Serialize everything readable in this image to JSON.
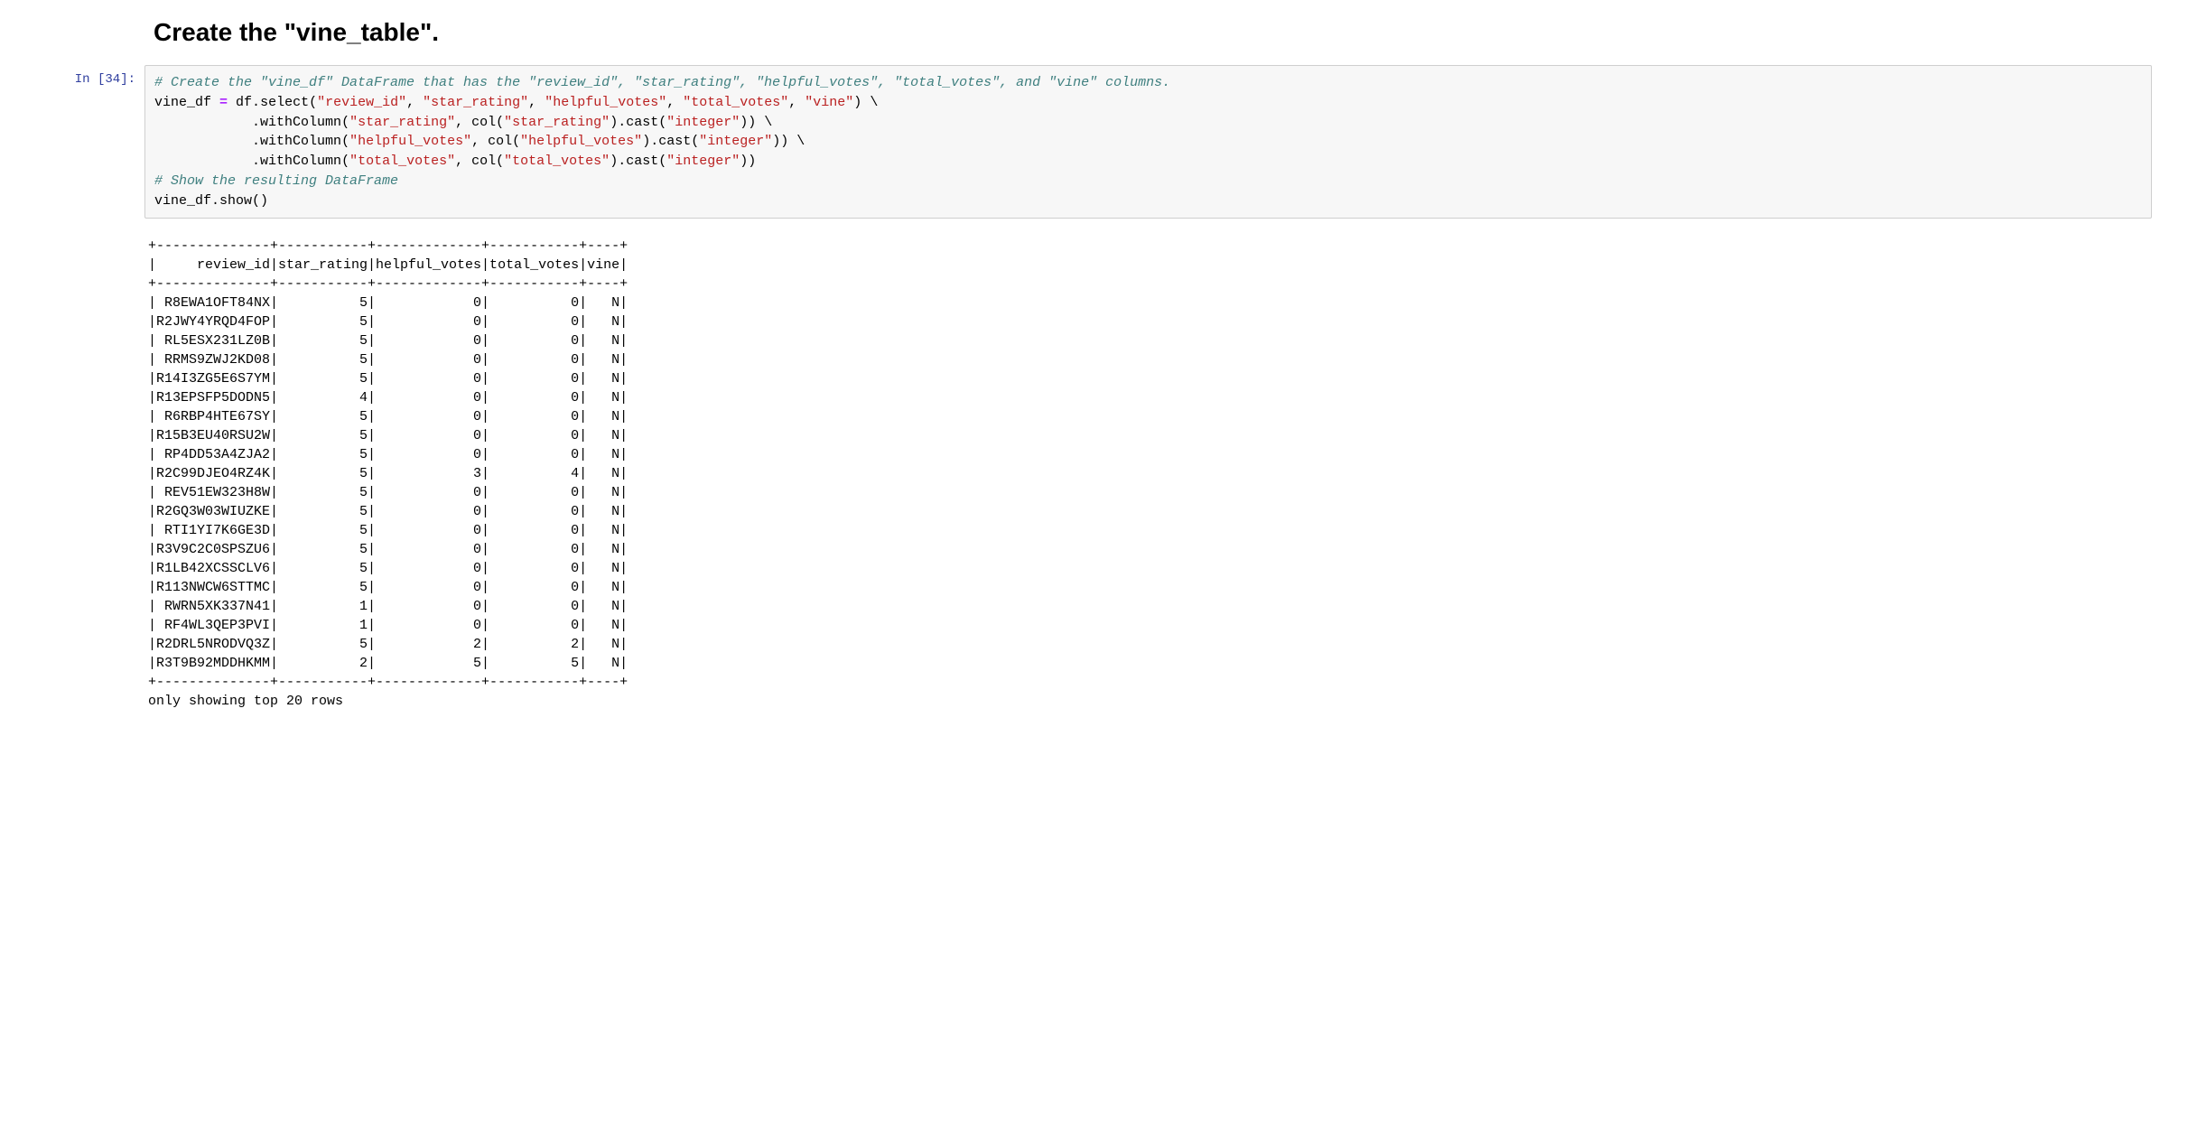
{
  "markdown": {
    "heading": "Create the \"vine_table\"."
  },
  "prompt": {
    "label": "In [34]:"
  },
  "code": {
    "comment1": "# Create the \"vine_df\" DataFrame that has the \"review_id\", \"star_rating\", \"helpful_votes\", \"total_votes\", and \"vine\" columns.",
    "lhs": "vine_df",
    "eq": " = ",
    "df": "df",
    "dot": ".",
    "select": "select",
    "lp": "(",
    "rp": ")",
    "comma": ", ",
    "s_review_id": "\"review_id\"",
    "s_star_rating": "\"star_rating\"",
    "s_helpful_votes": "\"helpful_votes\"",
    "s_total_votes": "\"total_votes\"",
    "s_vine": "\"vine\"",
    "s_integer": "\"integer\"",
    "bscont": " \\",
    "indent": "            ",
    "withColumn": "withColumn",
    "col": "col",
    "cast": "cast",
    "comment2": "# Show the resulting DataFrame",
    "show_lhs": "vine_df",
    "show": "show",
    "emptyparens": "()"
  },
  "output": {
    "sep": "+--------------+-----------+-------------+-----------+----+",
    "header": "|     review_id|star_rating|helpful_votes|total_votes|vine|",
    "footer": "only showing top 20 rows",
    "columns": [
      "review_id",
      "star_rating",
      "helpful_votes",
      "total_votes",
      "vine"
    ],
    "rows": [
      {
        "review_id": "R8EWA1OFT84NX",
        "star_rating": 5,
        "helpful_votes": 0,
        "total_votes": 0,
        "vine": "N"
      },
      {
        "review_id": "R2JWY4YRQD4FOP",
        "star_rating": 5,
        "helpful_votes": 0,
        "total_votes": 0,
        "vine": "N"
      },
      {
        "review_id": "RL5ESX231LZ0B",
        "star_rating": 5,
        "helpful_votes": 0,
        "total_votes": 0,
        "vine": "N"
      },
      {
        "review_id": "RRMS9ZWJ2KD08",
        "star_rating": 5,
        "helpful_votes": 0,
        "total_votes": 0,
        "vine": "N"
      },
      {
        "review_id": "R14I3ZG5E6S7YM",
        "star_rating": 5,
        "helpful_votes": 0,
        "total_votes": 0,
        "vine": "N"
      },
      {
        "review_id": "R13EPSFP5DODN5",
        "star_rating": 4,
        "helpful_votes": 0,
        "total_votes": 0,
        "vine": "N"
      },
      {
        "review_id": "R6RBP4HTE67SY",
        "star_rating": 5,
        "helpful_votes": 0,
        "total_votes": 0,
        "vine": "N"
      },
      {
        "review_id": "R15B3EU40RSU2W",
        "star_rating": 5,
        "helpful_votes": 0,
        "total_votes": 0,
        "vine": "N"
      },
      {
        "review_id": "RP4DD53A4ZJA2",
        "star_rating": 5,
        "helpful_votes": 0,
        "total_votes": 0,
        "vine": "N"
      },
      {
        "review_id": "R2C99DJEO4RZ4K",
        "star_rating": 5,
        "helpful_votes": 3,
        "total_votes": 4,
        "vine": "N"
      },
      {
        "review_id": "REV51EW323H8W",
        "star_rating": 5,
        "helpful_votes": 0,
        "total_votes": 0,
        "vine": "N"
      },
      {
        "review_id": "R2GQ3W03WIUZKE",
        "star_rating": 5,
        "helpful_votes": 0,
        "total_votes": 0,
        "vine": "N"
      },
      {
        "review_id": "RTI1YI7K6GE3D",
        "star_rating": 5,
        "helpful_votes": 0,
        "total_votes": 0,
        "vine": "N"
      },
      {
        "review_id": "R3V9C2C0SPSZU6",
        "star_rating": 5,
        "helpful_votes": 0,
        "total_votes": 0,
        "vine": "N"
      },
      {
        "review_id": "R1LB42XCSSCLV6",
        "star_rating": 5,
        "helpful_votes": 0,
        "total_votes": 0,
        "vine": "N"
      },
      {
        "review_id": "R113NWCW6STTMC",
        "star_rating": 5,
        "helpful_votes": 0,
        "total_votes": 0,
        "vine": "N"
      },
      {
        "review_id": "RWRN5XK337N41",
        "star_rating": 1,
        "helpful_votes": 0,
        "total_votes": 0,
        "vine": "N"
      },
      {
        "review_id": "RF4WL3QEP3PVI",
        "star_rating": 1,
        "helpful_votes": 0,
        "total_votes": 0,
        "vine": "N"
      },
      {
        "review_id": "R2DRL5NRODVQ3Z",
        "star_rating": 5,
        "helpful_votes": 2,
        "total_votes": 2,
        "vine": "N"
      },
      {
        "review_id": "R3T9B92MDDHKMM",
        "star_rating": 2,
        "helpful_votes": 5,
        "total_votes": 5,
        "vine": "N"
      }
    ],
    "widths": {
      "review_id": 14,
      "star_rating": 11,
      "helpful_votes": 13,
      "total_votes": 11,
      "vine": 4
    }
  },
  "chart_data": {
    "type": "table",
    "title": "vine_df top 20 rows",
    "columns": [
      "review_id",
      "star_rating",
      "helpful_votes",
      "total_votes",
      "vine"
    ],
    "rows": [
      [
        "R8EWA1OFT84NX",
        5,
        0,
        0,
        "N"
      ],
      [
        "R2JWY4YRQD4FOP",
        5,
        0,
        0,
        "N"
      ],
      [
        "RL5ESX231LZ0B",
        5,
        0,
        0,
        "N"
      ],
      [
        "RRMS9ZWJ2KD08",
        5,
        0,
        0,
        "N"
      ],
      [
        "R14I3ZG5E6S7YM",
        5,
        0,
        0,
        "N"
      ],
      [
        "R13EPSFP5DODN5",
        4,
        0,
        0,
        "N"
      ],
      [
        "R6RBP4HTE67SY",
        5,
        0,
        0,
        "N"
      ],
      [
        "R15B3EU40RSU2W",
        5,
        0,
        0,
        "N"
      ],
      [
        "RP4DD53A4ZJA2",
        5,
        0,
        0,
        "N"
      ],
      [
        "R2C99DJEO4RZ4K",
        5,
        3,
        4,
        "N"
      ],
      [
        "REV51EW323H8W",
        5,
        0,
        0,
        "N"
      ],
      [
        "R2GQ3W03WIUZKE",
        5,
        0,
        0,
        "N"
      ],
      [
        "RTI1YI7K6GE3D",
        5,
        0,
        0,
        "N"
      ],
      [
        "R3V9C2C0SPSZU6",
        5,
        0,
        0,
        "N"
      ],
      [
        "R1LB42XCSSCLV6",
        5,
        0,
        0,
        "N"
      ],
      [
        "R113NWCW6STTMC",
        5,
        0,
        0,
        "N"
      ],
      [
        "RWRN5XK337N41",
        1,
        0,
        0,
        "N"
      ],
      [
        "RF4WL3QEP3PVI",
        1,
        0,
        0,
        "N"
      ],
      [
        "R2DRL5NRODVQ3Z",
        5,
        2,
        2,
        "N"
      ],
      [
        "R3T9B92MDDHKMM",
        2,
        5,
        5,
        "N"
      ]
    ]
  }
}
